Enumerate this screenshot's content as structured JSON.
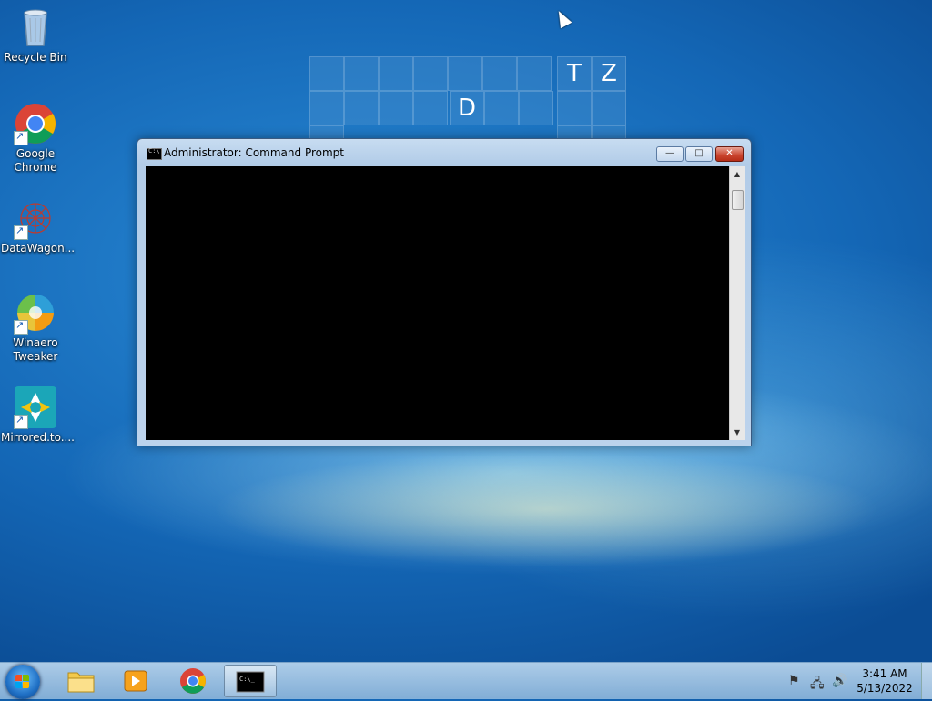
{
  "desktop": {
    "icons": [
      {
        "label": "Recycle Bin",
        "icon": "recycle-bin-icon"
      },
      {
        "label": "Google Chrome",
        "icon": "chrome-icon"
      },
      {
        "label": "DataWagon...",
        "icon": "datawagon-icon"
      },
      {
        "label": "Winaero Tweaker",
        "icon": "winaero-tweaker-icon"
      },
      {
        "label": "Mirrored.to....",
        "icon": "mirrored-to-icon"
      }
    ],
    "wallpaper_letters": [
      "T",
      "Z",
      "D"
    ]
  },
  "window": {
    "title": "Administrator: Command Prompt",
    "buttons": {
      "minimize": "—",
      "maximize": "□",
      "close": "✕"
    },
    "console_text": ""
  },
  "taskbar": {
    "items": [
      "start",
      "windows-explorer",
      "media-player",
      "chrome",
      "command-prompt"
    ],
    "active_item": "command-prompt",
    "tray_icons": [
      "action-center-flag-icon",
      "network-icon",
      "volume-icon"
    ],
    "clock": {
      "time": "3:41 AM",
      "date": "5/13/2022"
    }
  },
  "colors": {
    "console_bg": "#000000",
    "close_button": "#c9432d",
    "desktop_blue": "#1467b6"
  }
}
